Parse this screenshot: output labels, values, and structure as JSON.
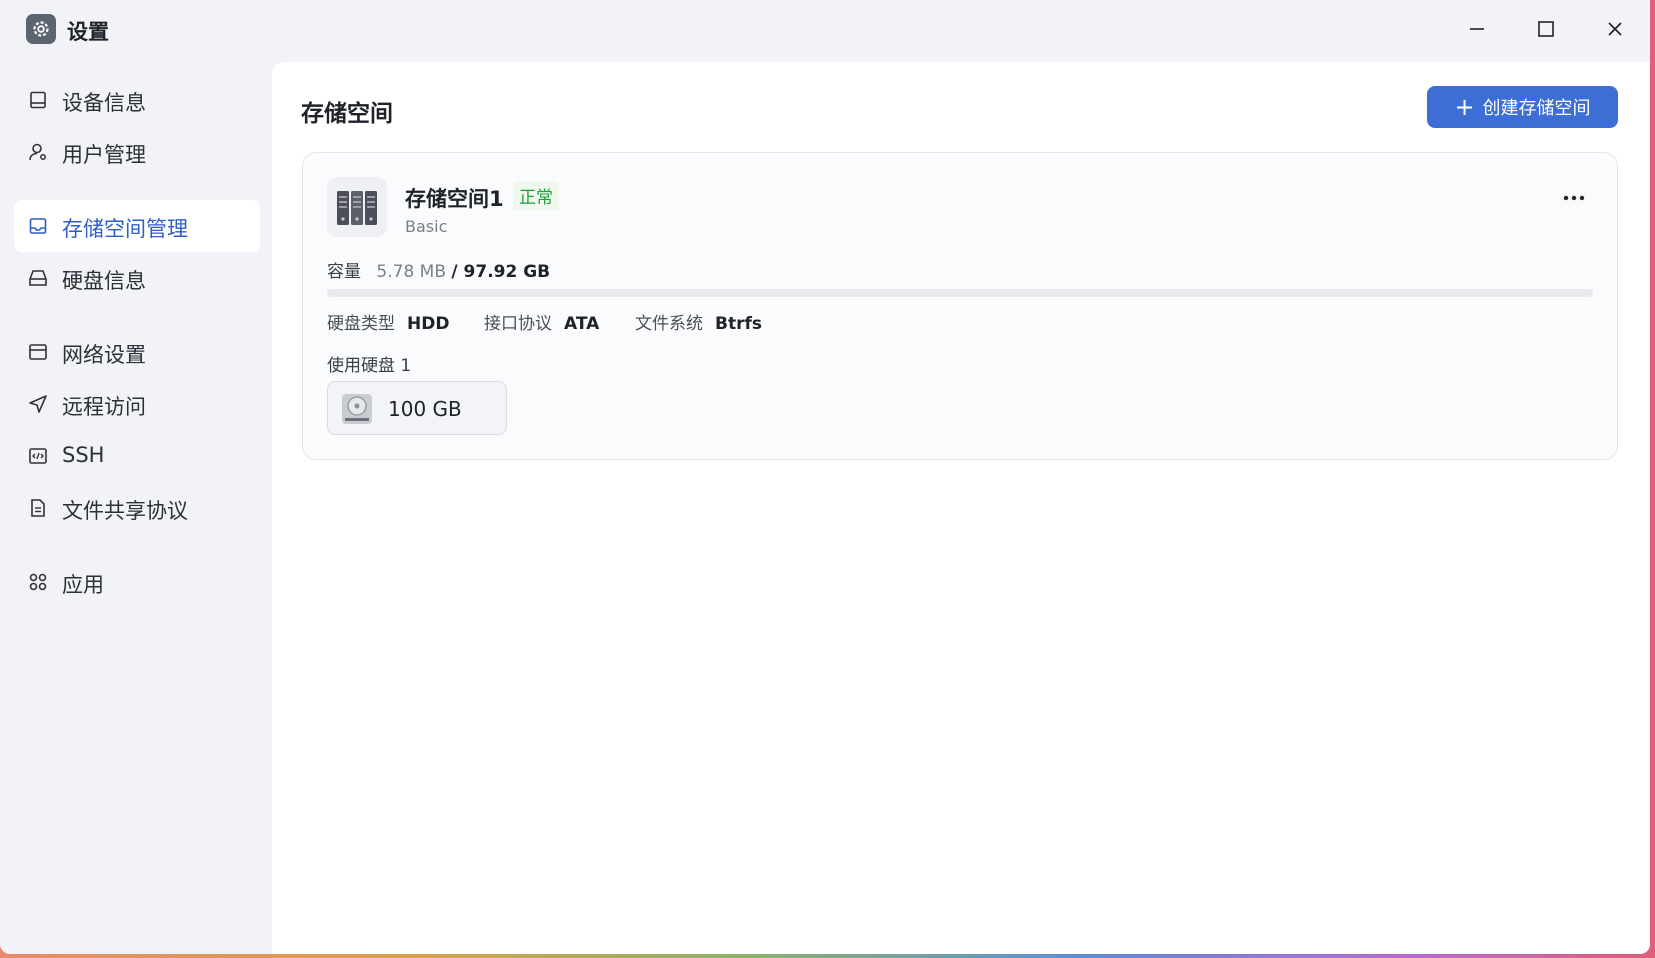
{
  "window": {
    "title": "设置",
    "icon": "gear-icon",
    "controls": [
      "minimize-icon",
      "maximize-icon",
      "close-icon"
    ]
  },
  "sidebar": {
    "items": [
      {
        "label": "设备信息",
        "icon": "device-icon",
        "active": false
      },
      {
        "label": "用户管理",
        "icon": "user-icon",
        "active": false
      },
      {
        "label": "存储空间管理",
        "icon": "storage-icon",
        "active": true
      },
      {
        "label": "硬盘信息",
        "icon": "harddisk-icon",
        "active": false
      },
      {
        "label": "网络设置",
        "icon": "network-icon",
        "active": false
      },
      {
        "label": "远程访问",
        "icon": "send-icon",
        "active": false
      },
      {
        "label": "SSH",
        "icon": "code-icon",
        "active": false
      },
      {
        "label": "文件共享协议",
        "icon": "document-icon",
        "active": false
      },
      {
        "label": "应用",
        "icon": "apps-icon",
        "active": false
      }
    ]
  },
  "main": {
    "title": "存储空间",
    "create_button": "创建存储空间",
    "volume": {
      "name": "存储空间1",
      "status": "正常",
      "type": "Basic",
      "capacity_label": "容量",
      "used": "5.78 MB",
      "total": "/ 97.92 GB",
      "usage_fraction": 0.0,
      "disk_type_label": "硬盘类型",
      "disk_type": "HDD",
      "interface_label": "接口协议",
      "interface": "ATA",
      "filesystem_label": "文件系统",
      "filesystem": "Btrfs",
      "disks_used_label": "使用硬盘 1",
      "disk_size": "100 GB"
    }
  },
  "colors": {
    "accent": "#3d6ed6",
    "status_ok": "#19a33a",
    "sidebar_bg": "#f2f3f8"
  }
}
